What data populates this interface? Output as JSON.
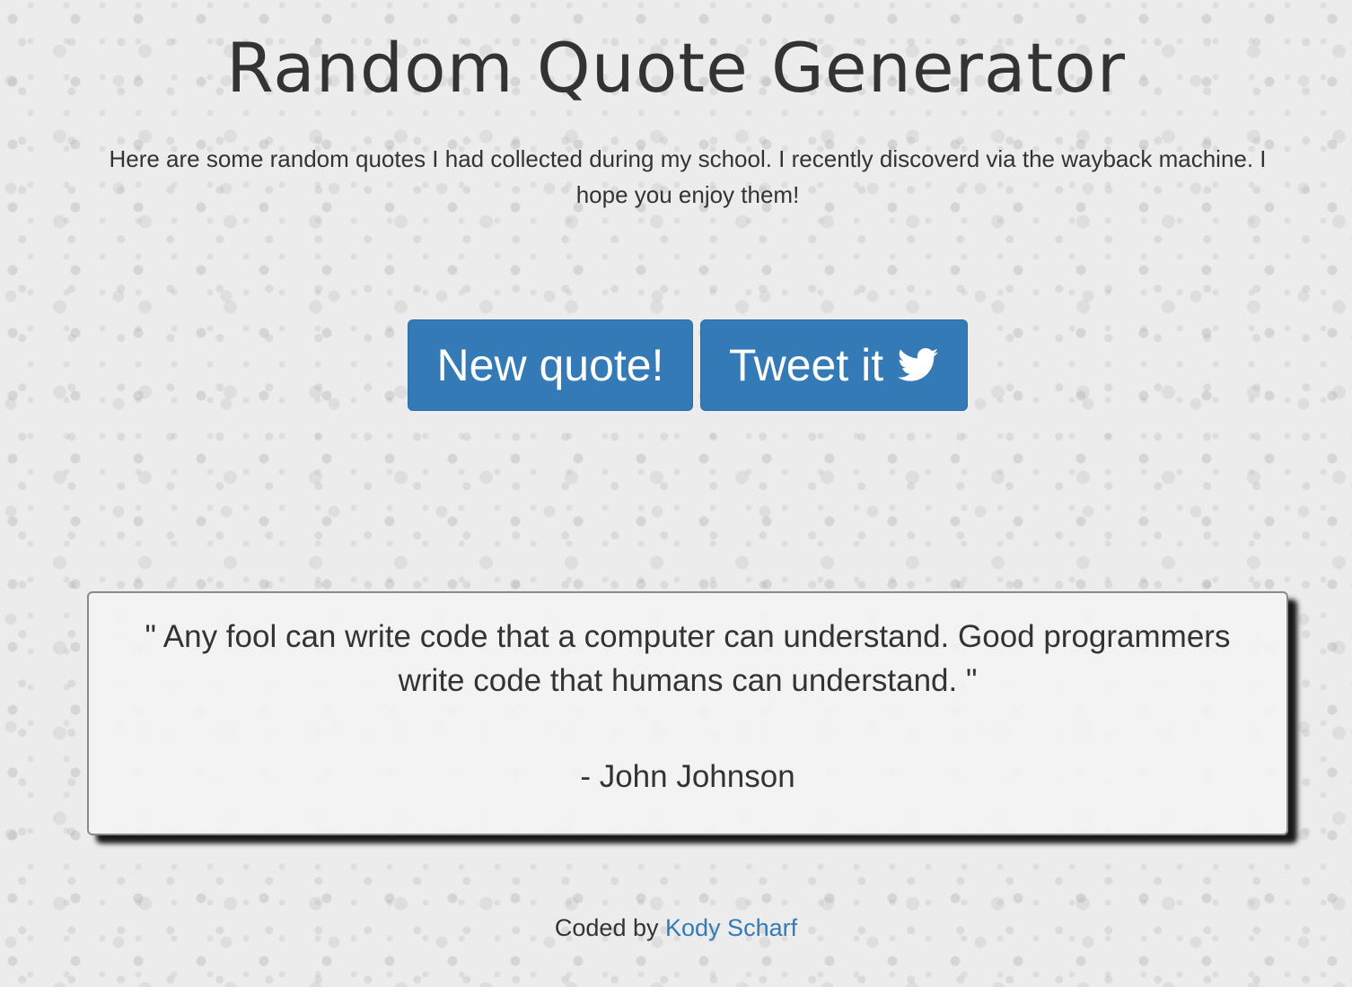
{
  "header": {
    "title": "Random Quote Generator",
    "intro": "Here are some random quotes I had collected during my school. I recently discoverd via the wayback machine. I hope you enjoy them!"
  },
  "buttons": {
    "new_quote_label": "New quote!",
    "tweet_label": "Tweet it",
    "tweet_icon": "twitter-bird-icon",
    "color": "#337ab7"
  },
  "quote": {
    "text": "\" Any fool can write code that a computer can understand. Good programmers write code that humans can understand. \"",
    "author": "- John Johnson"
  },
  "footer": {
    "prefix": "Coded by",
    "author_link_text": "Kody Scharf",
    "link_color": "#337ab7"
  }
}
